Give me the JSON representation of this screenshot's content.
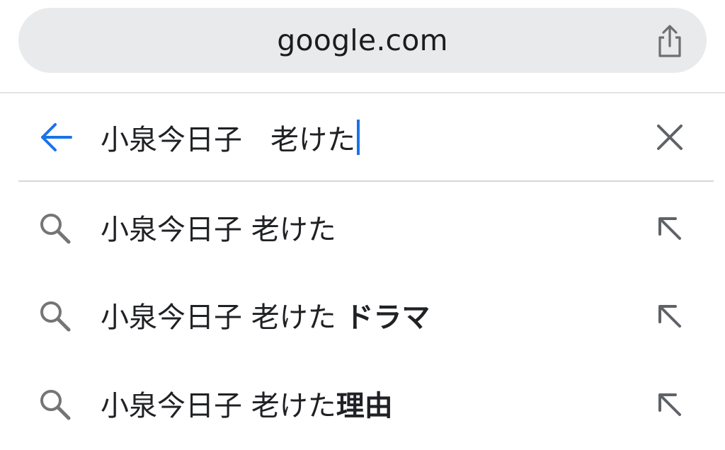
{
  "browser": {
    "url": "google.com",
    "share_icon": "share-icon"
  },
  "search": {
    "back_icon": "arrow-back-icon",
    "query": "小泉今日子　老けた",
    "clear_icon": "close-icon"
  },
  "suggestions": [
    {
      "prefix": "小泉今日子 老けた",
      "bold": ""
    },
    {
      "prefix": "小泉今日子 老けた ",
      "bold": "ドラマ"
    },
    {
      "prefix": "小泉今日子 老けた",
      "bold": "理由"
    }
  ],
  "colors": {
    "accent": "#1a73e8",
    "icon_gray": "#757575",
    "url_bar_bg": "#e9eaec"
  }
}
